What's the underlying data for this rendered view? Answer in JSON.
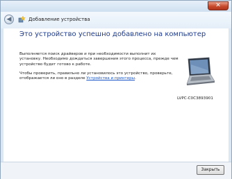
{
  "window": {
    "close_glyph": "✕"
  },
  "navbar": {
    "back_glyph": "◀",
    "title": "Добавление устройства"
  },
  "main": {
    "heading": "Это устройство успешно добавлено на компьютер",
    "para1": "Выполняется поиск драйверов и при необходимости выполнит их установку. Необходимо дождаться завершения этого процесса, прежде чем устройство будет готово к работе.",
    "para2_prefix": "Чтобы проверить, правильно ли установилось это устройство, проверьте, отображается ли оно в разделе ",
    "para2_link": "Устройства и принтеры",
    "para2_suffix": ".",
    "device_name": "LVPC-C0C3893901",
    "device_icon": "laptop-icon"
  },
  "footer": {
    "close_label": "Закрыть"
  },
  "colors": {
    "heading": "#1e3a8a",
    "link": "#1a56c7",
    "close": "#c84a2c"
  }
}
